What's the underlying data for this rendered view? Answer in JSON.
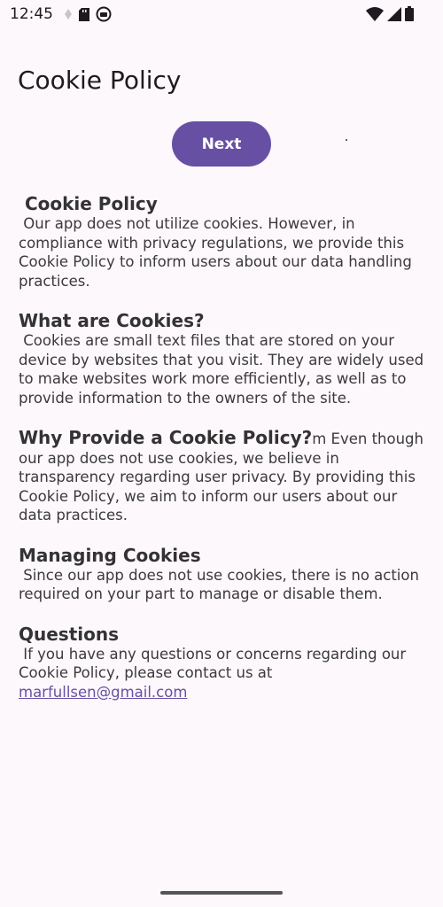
{
  "status_bar": {
    "time": "12:45"
  },
  "app_bar": {
    "title": "Cookie Policy"
  },
  "next_button": {
    "label": "Next"
  },
  "sections": [
    {
      "heading": " Cookie Policy",
      "body": " Our app does not utilize cookies. However, in compliance with privacy regulations, we provide this Cookie Policy to inform users about our data handling practices."
    },
    {
      "heading": "What are Cookies?",
      "body": " Cookies are small text files that are stored on your device by websites that you visit. They are widely used to make websites work more efficiently, as well as to provide information to the owners of the site."
    },
    {
      "heading": "Why Provide a Cookie Policy?",
      "body": "m Even though our app does not use cookies, we believe in transparency regarding user privacy. By providing this Cookie Policy, we aim to inform our users about our data practices."
    },
    {
      "heading": "Managing Cookies",
      "body": " Since our app does not use cookies, there is no action required on your part to manage or disable them."
    },
    {
      "heading": "Questions",
      "body": " If you have any questions or concerns regarding our Cookie Policy, please contact us at ",
      "link": "marfullsen@gmail.com"
    }
  ],
  "colors": {
    "accent": "#6750a4",
    "background": "#fdf8fc"
  }
}
